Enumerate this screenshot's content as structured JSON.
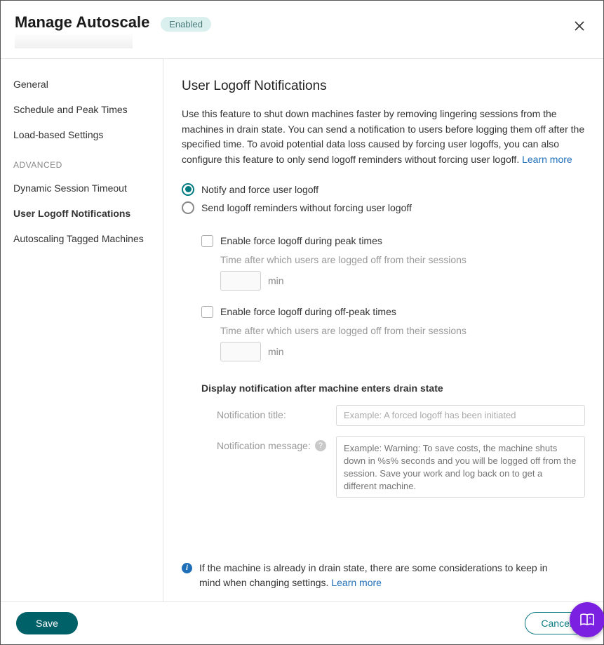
{
  "header": {
    "title": "Manage Autoscale",
    "status": "Enabled"
  },
  "sidebar": {
    "items": [
      {
        "label": "General"
      },
      {
        "label": "Schedule and Peak Times"
      },
      {
        "label": "Load-based Settings"
      }
    ],
    "advanced_heading": "ADVANCED",
    "advanced_items": [
      {
        "label": "Dynamic Session Timeout"
      },
      {
        "label": "User Logoff Notifications"
      },
      {
        "label": "Autoscaling Tagged Machines"
      }
    ]
  },
  "main": {
    "title": "User Logoff Notifications",
    "description": "Use this feature to shut down machines faster by removing lingering sessions from the machines in drain state. You can send a notification to users before logging them off after the specified time. To avoid potential data loss caused by forcing user logoffs, you can also configure this feature to only send logoff reminders without forcing user logoff. ",
    "learn_more": "Learn more",
    "radio_notify": "Notify and force user logoff",
    "radio_reminders": "Send logoff reminders without forcing user logoff",
    "peak": {
      "check_label": "Enable force logoff during peak times",
      "sub": "Time after which users are logged off from their sessions",
      "unit": "min"
    },
    "offpeak": {
      "check_label": "Enable force logoff during off-peak times",
      "sub": "Time after which users are logged off from their sessions",
      "unit": "min"
    },
    "notif_section": {
      "heading": "Display notification after machine enters drain state",
      "title_label": "Notification title:",
      "title_placeholder": "Example: A forced logoff has been initiated",
      "message_label": "Notification message:",
      "message_placeholder": "Example: Warning: To save costs, the machine shuts down in %s% seconds and you will be logged off from the session. Save your work and log back on to get a different machine."
    },
    "info": {
      "text": "If the machine is already in drain state, there are some considerations to keep in mind when changing settings. ",
      "link": "Learn more"
    }
  },
  "footer": {
    "save": "Save",
    "cancel": "Cancel"
  }
}
